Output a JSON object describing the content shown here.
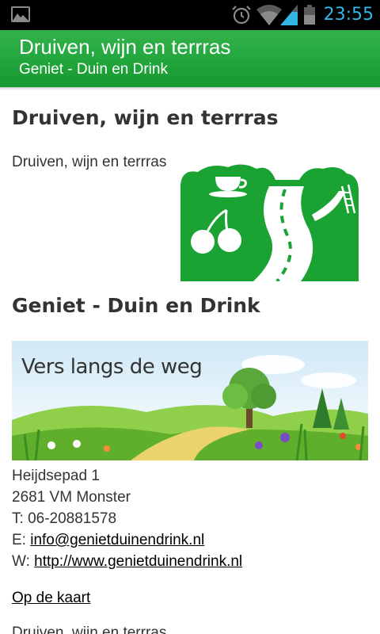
{
  "status_bar": {
    "time": "23:55",
    "icons": [
      "gallery-icon",
      "alarm-icon",
      "wifi-icon",
      "signal-icon",
      "battery-icon"
    ],
    "time_color": "#33b5e5"
  },
  "action_bar": {
    "title": "Druiven, wijn en terrras",
    "subtitle": "Geniet - Duin en Drink",
    "color": "#24a83f"
  },
  "content": {
    "section1": {
      "heading": "Druiven, wijn en terrras",
      "text": "Druiven, wijn en terrras",
      "logo_icons": [
        "coffee-cup-icon",
        "cherries-icon",
        "road-icon",
        "slide-icon"
      ],
      "logo_color": "#1aa332"
    },
    "section2": {
      "heading": "Geniet - Duin en Drink",
      "banner_text": "Vers langs de weg",
      "address_line1": "Heijdsepad 1",
      "address_line2": "2681 VM Monster",
      "phone_prefix": "T: ",
      "phone": "06-20881578",
      "email_prefix": "E: ",
      "email": "info@genietduinendrink.nl",
      "web_prefix": "W: ",
      "website": "http://www.genietduinendrink.nl",
      "map_link": "Op de kaart"
    },
    "next_item_text": "Druiven, wijn en terrras"
  }
}
